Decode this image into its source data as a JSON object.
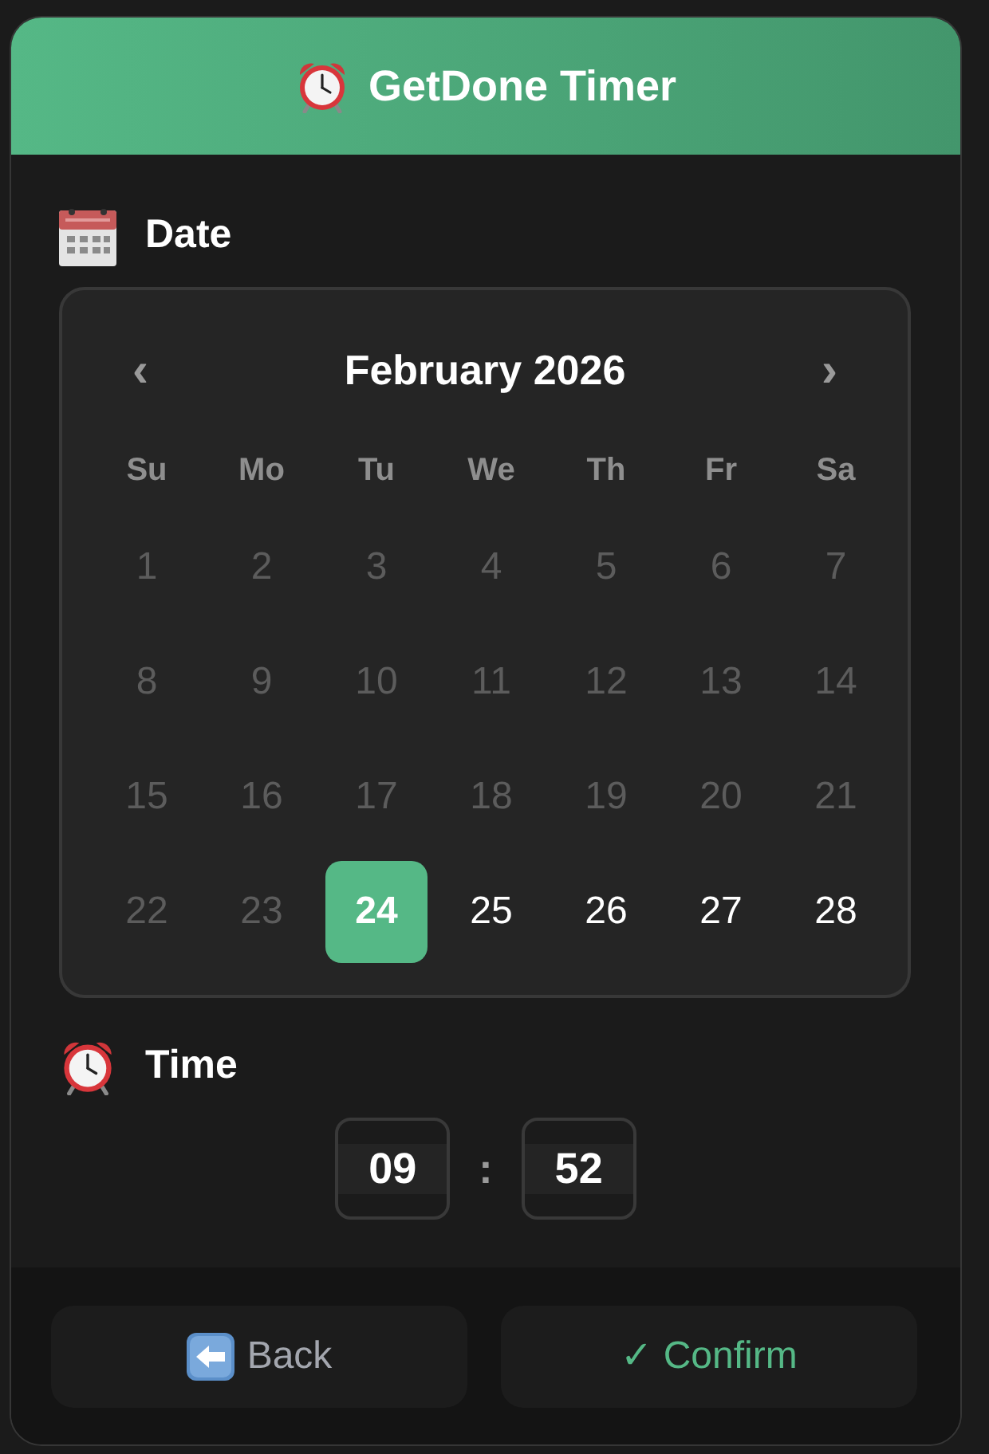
{
  "header": {
    "title": "GetDone Timer"
  },
  "date": {
    "label": "Date"
  },
  "calendar": {
    "prev": "‹",
    "title": "February 2026",
    "next": "›",
    "weekdays": [
      "Su",
      "Mo",
      "Tu",
      "We",
      "Th",
      "Fr",
      "Sa"
    ],
    "days": [
      {
        "label": "1",
        "disabled": true,
        "selected": false
      },
      {
        "label": "2",
        "disabled": true,
        "selected": false
      },
      {
        "label": "3",
        "disabled": true,
        "selected": false
      },
      {
        "label": "4",
        "disabled": true,
        "selected": false
      },
      {
        "label": "5",
        "disabled": true,
        "selected": false
      },
      {
        "label": "6",
        "disabled": true,
        "selected": false
      },
      {
        "label": "7",
        "disabled": true,
        "selected": false
      },
      {
        "label": "8",
        "disabled": true,
        "selected": false
      },
      {
        "label": "9",
        "disabled": true,
        "selected": false
      },
      {
        "label": "10",
        "disabled": true,
        "selected": false
      },
      {
        "label": "11",
        "disabled": true,
        "selected": false
      },
      {
        "label": "12",
        "disabled": true,
        "selected": false
      },
      {
        "label": "13",
        "disabled": true,
        "selected": false
      },
      {
        "label": "14",
        "disabled": true,
        "selected": false
      },
      {
        "label": "15",
        "disabled": true,
        "selected": false
      },
      {
        "label": "16",
        "disabled": true,
        "selected": false
      },
      {
        "label": "17",
        "disabled": true,
        "selected": false
      },
      {
        "label": "18",
        "disabled": true,
        "selected": false
      },
      {
        "label": "19",
        "disabled": true,
        "selected": false
      },
      {
        "label": "20",
        "disabled": true,
        "selected": false
      },
      {
        "label": "21",
        "disabled": true,
        "selected": false
      },
      {
        "label": "22",
        "disabled": true,
        "selected": false
      },
      {
        "label": "23",
        "disabled": true,
        "selected": false
      },
      {
        "label": "24",
        "disabled": false,
        "selected": true
      },
      {
        "label": "25",
        "disabled": false,
        "selected": false
      },
      {
        "label": "26",
        "disabled": false,
        "selected": false
      },
      {
        "label": "27",
        "disabled": false,
        "selected": false
      },
      {
        "label": "28",
        "disabled": false,
        "selected": false
      }
    ]
  },
  "time": {
    "label": "Time",
    "hour": "09",
    "separator": ":",
    "minute": "52"
  },
  "buttons": [
    {
      "kind": "back",
      "label": "Back"
    },
    {
      "kind": "confirm",
      "label": "✓ Confirm"
    }
  ]
}
